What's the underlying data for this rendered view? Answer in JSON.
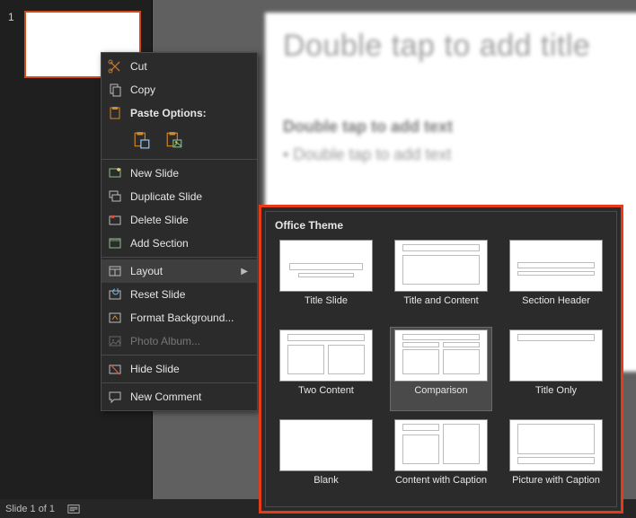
{
  "thumb": {
    "number": "1"
  },
  "editor": {
    "title_placeholder": "Double tap to add title",
    "text_placeholder_bold": "Double tap to add text",
    "text_placeholder_bullet": "• Double tap to add text"
  },
  "status": {
    "slide_of": "Slide 1 of 1"
  },
  "ctx": {
    "cut": "Cut",
    "copy": "Copy",
    "paste_options": "Paste Options:",
    "new_slide": "New Slide",
    "duplicate_slide": "Duplicate Slide",
    "delete_slide": "Delete Slide",
    "add_section": "Add Section",
    "layout": "Layout",
    "reset_slide": "Reset Slide",
    "format_background": "Format Background...",
    "photo_album": "Photo Album...",
    "hide_slide": "Hide Slide",
    "new_comment": "New Comment"
  },
  "flyout": {
    "heading": "Office Theme",
    "items": [
      "Title Slide",
      "Title and Content",
      "Section Header",
      "Two Content",
      "Comparison",
      "Title Only",
      "Blank",
      "Content with Caption",
      "Picture with Caption"
    ],
    "selected_index": 4
  }
}
